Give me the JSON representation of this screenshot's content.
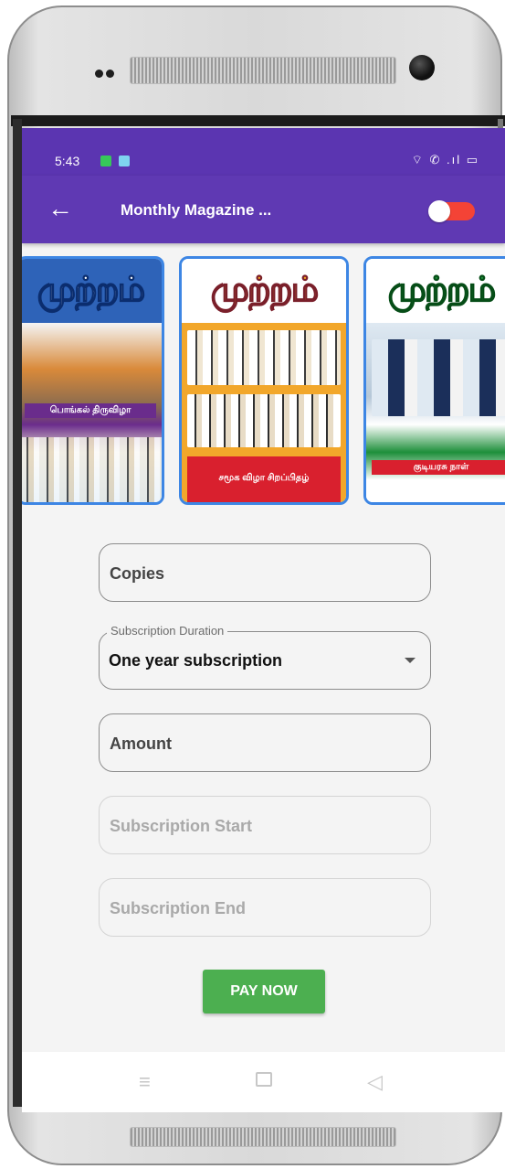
{
  "status_bar": {
    "time": "5:43",
    "right_icons": "⌔ ✆ .ıl ▭"
  },
  "app_bar": {
    "title": "Monthly Magazine ...",
    "back_icon": "←",
    "toggle_on": true,
    "toggle_color": "#f44336"
  },
  "carousel": {
    "items": [
      {
        "logo": "முற்றம்",
        "banner": "பொங்கல் திருவிழா"
      },
      {
        "logo": "முற்றம்",
        "banner": "சமூக விழா சிறப்பிதழ்"
      },
      {
        "logo": "முற்றம்",
        "banner": "குடியரசு நாள்"
      }
    ]
  },
  "form": {
    "copies_placeholder": "Copies",
    "duration_label": "Subscription Duration",
    "duration_value": "One year subscription",
    "amount_placeholder": "Amount",
    "start_placeholder": "Subscription Start",
    "end_placeholder": "Subscription End"
  },
  "pay_button": {
    "label": "PAY NOW",
    "color": "#4caf50"
  },
  "nav": {
    "menu_icon": "≡",
    "back_icon": "◁"
  },
  "colors": {
    "primary": "#5f39b3",
    "accent": "#3d86e4"
  }
}
